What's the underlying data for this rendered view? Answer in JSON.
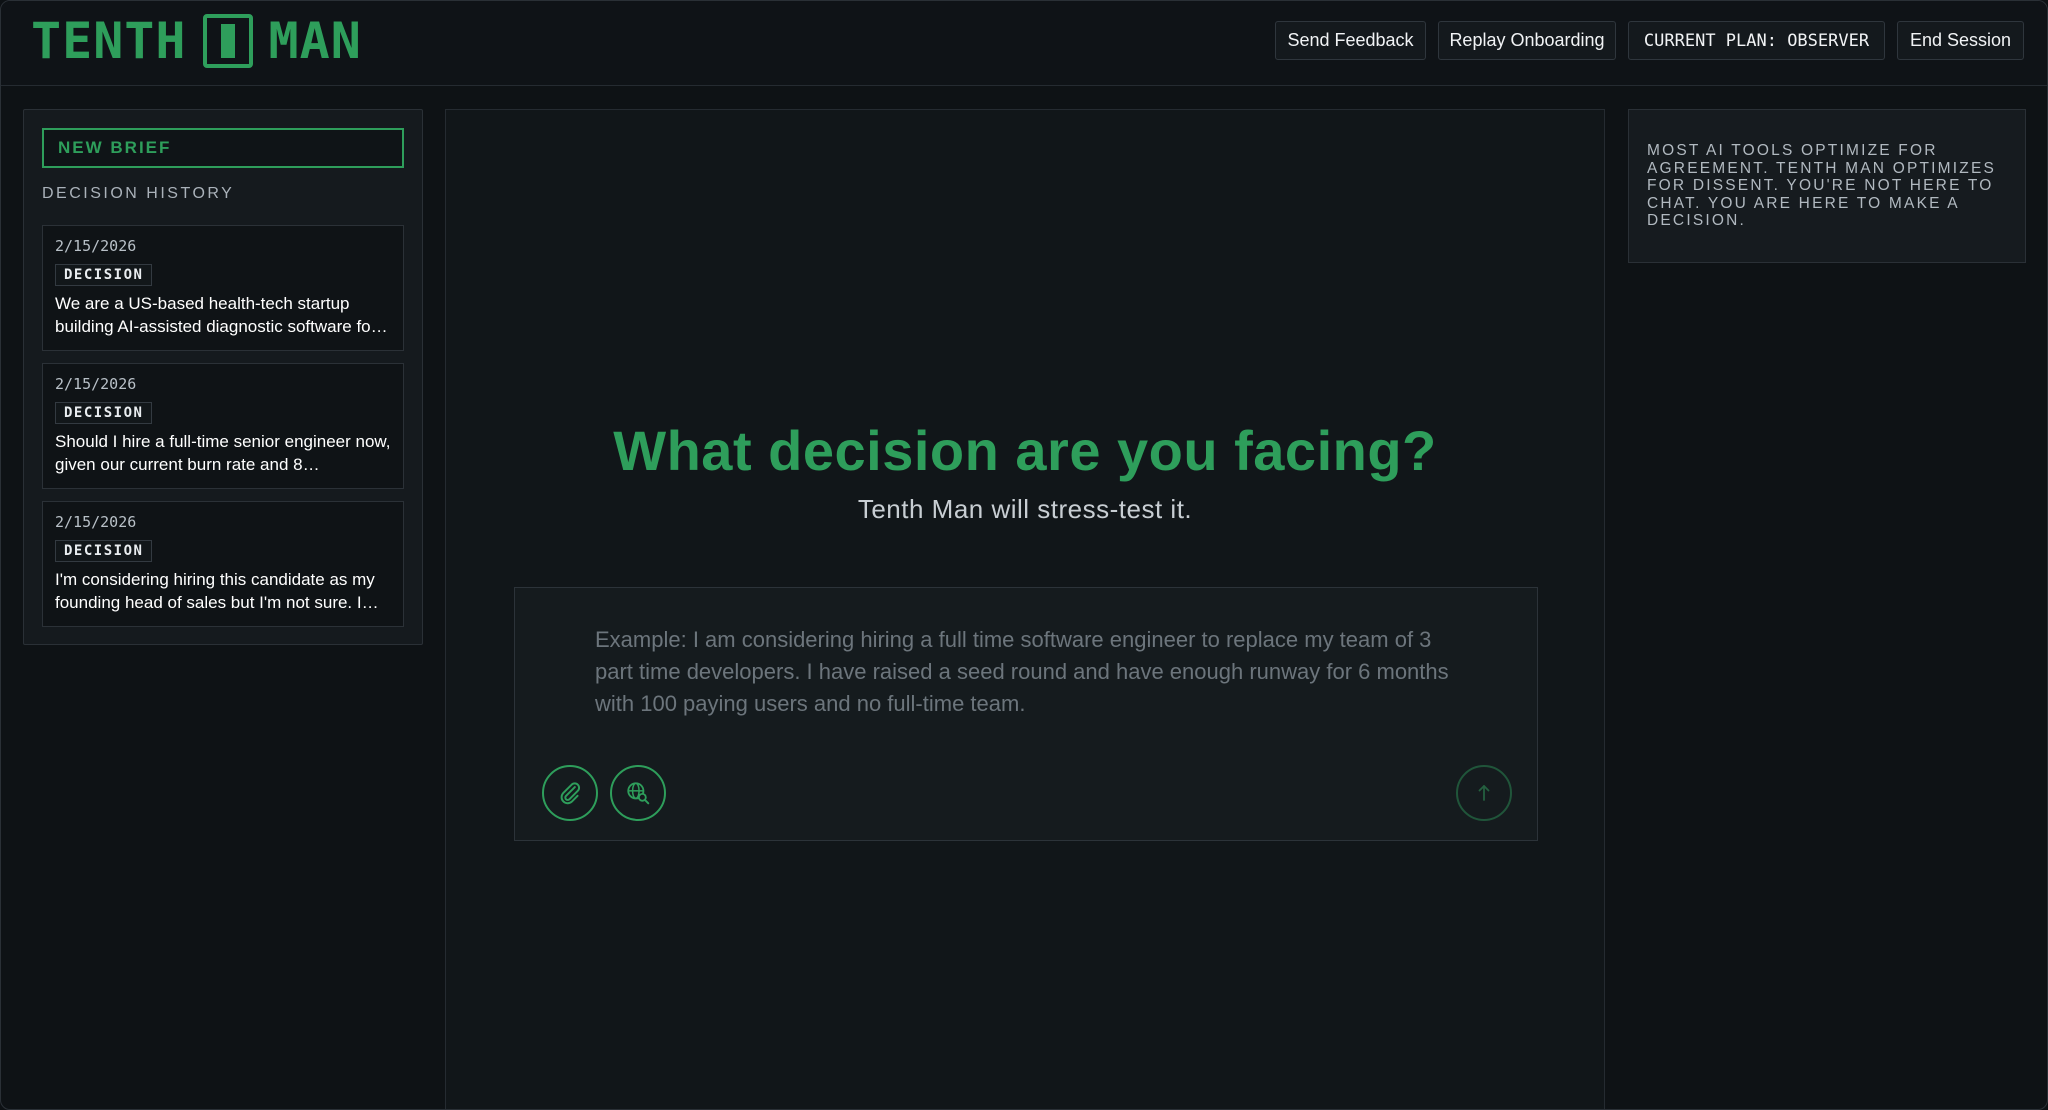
{
  "brand": {
    "left_word": "TENTH",
    "right_word": "MAN",
    "accent_color": "#2e9e5b"
  },
  "header": {
    "buttons": {
      "feedback": "Send Feedback",
      "onboarding": "Replay Onboarding",
      "plan": "CURRENT PLAN: OBSERVER",
      "end_session": "End Session"
    }
  },
  "sidebar": {
    "new_brief_label": "NEW BRIEF",
    "history_label": "DECISION HISTORY",
    "items": [
      {
        "date": "2/15/2026",
        "badge": "DECISION",
        "text": "We are a US-based health-tech startup building AI-assisted diagnostic software fo…"
      },
      {
        "date": "2/15/2026",
        "badge": "DECISION",
        "text": "Should I hire a full-time senior engineer now, given our current burn rate and 8…"
      },
      {
        "date": "2/15/2026",
        "badge": "DECISION",
        "text": "I'm considering hiring this candidate as my founding head of sales but I'm not sure. I…"
      }
    ]
  },
  "main": {
    "title": "What decision are you facing?",
    "subtitle": "Tenth Man will stress-test it.",
    "composer": {
      "placeholder": "Example: I am considering hiring a full time software engineer to replace my team of 3 part time developers. I have raised a seed round and have enough runway for 6 months with 100 paying users and no full-time team.",
      "value": "",
      "attach_icon": "paperclip-icon",
      "web_search_icon": "globe-search-icon",
      "send_icon": "arrow-up-icon"
    }
  },
  "info_panel": {
    "text": "MOST AI TOOLS OPTIMIZE FOR AGREEMENT. TENTH MAN OPTIMIZES FOR DISSENT. YOU'RE NOT HERE TO CHAT. YOU ARE HERE TO MAKE A DECISION."
  }
}
